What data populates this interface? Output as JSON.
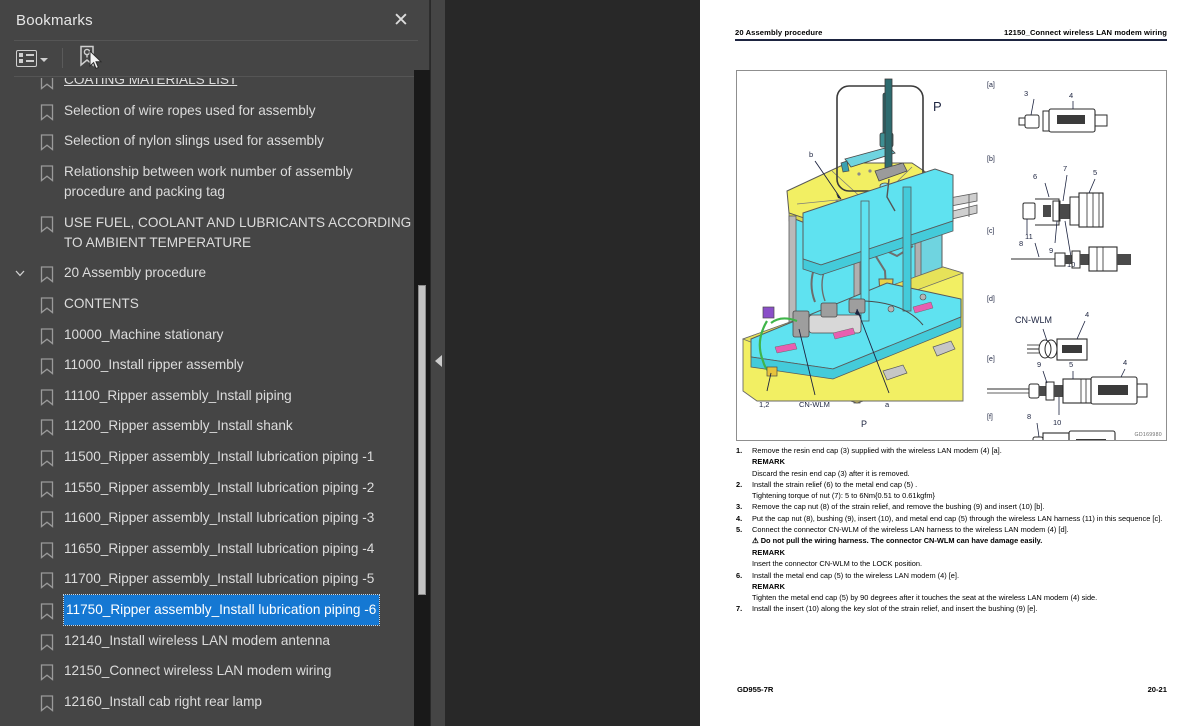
{
  "panel": {
    "title": "Bookmarks",
    "close_label": "✕",
    "toolbar": {
      "options_icon": "list-options-icon",
      "dropdown_icon": "chevron-down-icon",
      "new_bookmark_icon": "new-bookmark-icon",
      "cursor_icon": "mouse-cursor-icon"
    },
    "selected_index": 12,
    "hovered_index": 0,
    "items": [
      {
        "label": "COATING MATERIALS LIST",
        "level": 1,
        "state": "hovered",
        "clipped": true
      },
      {
        "label": "Selection of wire ropes used for assembly",
        "level": 1
      },
      {
        "label": "Selection of nylon slings used for assembly",
        "level": 1
      },
      {
        "label": "Relationship between work number of assembly\nprocedure and packing tag",
        "level": 1
      },
      {
        "label": "USE FUEL, COOLANT AND LUBRICANTS ACCORDING\nTO AMBIENT TEMPERATURE",
        "level": 1
      },
      {
        "label": "20 Assembly procedure",
        "level": 0,
        "expanded": true,
        "twisty": "chevron-down-icon"
      },
      {
        "label": "CONTENTS",
        "level": 1
      },
      {
        "label": "10000_Machine stationary",
        "level": 1
      },
      {
        "label": "11000_Install ripper assembly",
        "level": 1
      },
      {
        "label": "11100_Ripper assembly_Install piping",
        "level": 1
      },
      {
        "label": "11200_Ripper assembly_Install shank",
        "level": 1
      },
      {
        "label": "11500_Ripper assembly_Install lubrication piping -1",
        "level": 1
      },
      {
        "label": "11550_Ripper assembly_Install lubrication piping -2",
        "level": 1
      },
      {
        "label": "11600_Ripper assembly_Install lubrication piping -3",
        "level": 1
      },
      {
        "label": "11650_Ripper assembly_Install lubrication piping -4",
        "level": 1
      },
      {
        "label": "11700_Ripper assembly_Install lubrication piping -5",
        "level": 1
      },
      {
        "label": "11750_Ripper assembly_Install lubrication piping -6",
        "level": 1,
        "state": "selected"
      },
      {
        "label": "12140_Install wireless LAN modem antenna",
        "level": 1
      },
      {
        "label": "12150_Connect wireless LAN modem wiring",
        "level": 1
      },
      {
        "label": "12160_Install cab right rear lamp",
        "level": 1
      }
    ],
    "colors": {
      "panel_bg": "#454545",
      "selection_blue": "#1578d3",
      "text": "#dcdcdc",
      "reader_bg": "#282828"
    }
  },
  "reader": {
    "collapse_icon": "collapse-left-triangle-icon"
  },
  "document": {
    "header_left": "20 Assembly procedure",
    "header_right": "12150_Connect wireless LAN modem wiring",
    "figure_id": "GD169980",
    "footer_left": "GD955-7R",
    "footer_right": "20-21",
    "figure": {
      "callouts_top": {
        "letter": "P",
        "sub_label": "P"
      },
      "panels": [
        {
          "tag": "[a]",
          "numbers": [
            "3",
            "4"
          ]
        },
        {
          "tag": "[b]",
          "numbers": [
            "6",
            "7",
            "5",
            "8",
            "9",
            "10"
          ]
        },
        {
          "tag": "[c]",
          "numbers": [
            "11"
          ]
        },
        {
          "tag": "[d]",
          "numbers": [
            "4"
          ],
          "text": "CN-WLM"
        },
        {
          "tag": "[e]",
          "numbers": [
            "9",
            "5",
            "4",
            "10"
          ]
        },
        {
          "tag": "[f]",
          "numbers": [
            "8"
          ]
        }
      ],
      "lower_labels": [
        "b",
        "1,2",
        "CN-WLM",
        "a",
        "P"
      ]
    },
    "steps": [
      {
        "num": "1.",
        "text": "Remove the resin end cap (3) supplied with the wireless LAN modem (4) [a].",
        "sub": [
          {
            "kind": "heading",
            "text": "REMARK"
          },
          {
            "kind": "body",
            "text": "Discard the resin end cap (3) after it is removed."
          }
        ]
      },
      {
        "num": "2.",
        "text": "Install the strain relief (6) to the metal end cap (5) .",
        "sub": [
          {
            "kind": "body",
            "text": "Tightening torque of nut (7): 5 to 6Nm{0.51 to 0.61kgfm}"
          }
        ]
      },
      {
        "num": "3.",
        "text": "Remove the cap nut (8) of the strain relief, and remove the bushing (9) and insert (10) [b].",
        "sub": []
      },
      {
        "num": "4.",
        "text": "Put the cap nut (8), bushing (9), insert (10), and metal end cap (5) through the wireless LAN harness (11) in this sequence [c].",
        "sub": []
      },
      {
        "num": "5.",
        "text": "Connect the connector CN-WLM of the wireless LAN harness to the wireless LAN modem (4) [d].",
        "sub": [
          {
            "kind": "warning",
            "text": "Do not pull the wiring harness. The connector CN-WLM can have damage easily."
          },
          {
            "kind": "heading",
            "text": "REMARK"
          },
          {
            "kind": "body",
            "text": "Insert the connector CN-WLM to the LOCK position."
          }
        ]
      },
      {
        "num": "6.",
        "text": "Install the metal end cap (5) to the wireless LAN modem (4) [e].",
        "sub": [
          {
            "kind": "heading",
            "text": "REMARK"
          },
          {
            "kind": "body",
            "text": "Tighten the metal end cap (5) by 90 degrees after it touches the seat at the wireless LAN modem (4) side."
          }
        ]
      },
      {
        "num": "7.",
        "text": "Install the insert (10) along the key slot of the strain relief, and insert the bushing (9) [e].",
        "sub": []
      }
    ]
  }
}
